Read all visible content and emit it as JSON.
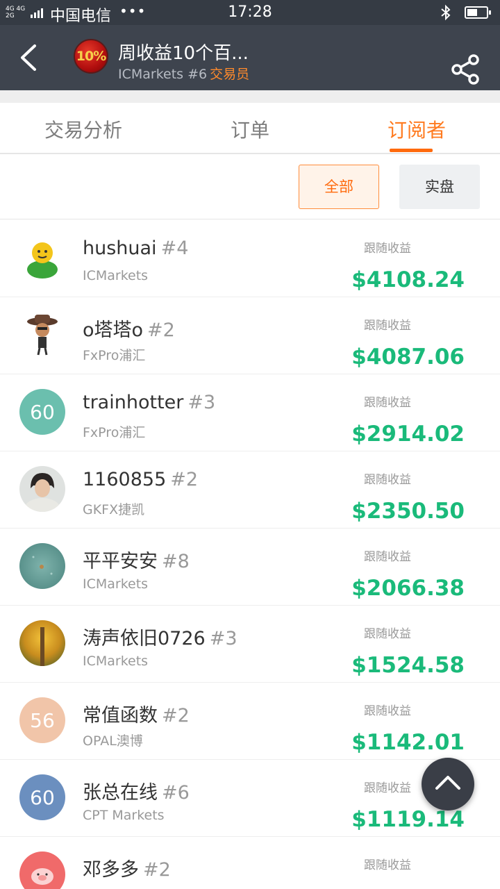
{
  "status_bar": {
    "network_top": "4G 4G",
    "network_bottom": "2G",
    "carrier": "中国电信",
    "dots": "•••",
    "time": "17:28"
  },
  "header": {
    "logo_text": "10%",
    "title": "周收益10个百...",
    "broker_rank": "ICMarkets #6",
    "role": "交易员"
  },
  "tabs": [
    {
      "label": "交易分析",
      "active": false
    },
    {
      "label": "订单",
      "active": false
    },
    {
      "label": "订阅者",
      "active": true
    }
  ],
  "filters": {
    "all": "全部",
    "real": "实盘"
  },
  "colors": {
    "accent": "#ff6a0d",
    "profit": "#1aba7a",
    "header_bg": "#3e444e",
    "status_bg": "#353b44"
  },
  "subscribers": [
    {
      "name": "hushuai",
      "rank": "#4",
      "broker": "ICMarkets",
      "profit_label": "跟随收益",
      "profit": "$4108.24",
      "avatar_icon": "smiley-avatar-icon"
    },
    {
      "name": "o塔塔o",
      "rank": "#2",
      "broker": "FxPro浦汇",
      "profit_label": "跟随收益",
      "profit": "$4087.06",
      "avatar_icon": "cowboy-avatar-icon"
    },
    {
      "name": "trainhotter",
      "rank": "#3",
      "broker": "FxPro浦汇",
      "profit_label": "跟随收益",
      "profit": "$2914.02",
      "avatar_text": "60",
      "avatar_color": "#6bbfae"
    },
    {
      "name": "1160855",
      "rank": "#2",
      "broker": "GKFX捷凯",
      "profit_label": "跟随收益",
      "profit": "$2350.50",
      "avatar_icon": "person-photo-icon"
    },
    {
      "name": "平平安安",
      "rank": "#8",
      "broker": "ICMarkets",
      "profit_label": "跟随收益",
      "profit": "$2066.38",
      "avatar_icon": "teal-texture-icon"
    },
    {
      "name": "涛声依旧0726",
      "rank": "#3",
      "broker": "ICMarkets",
      "profit_label": "跟随收益",
      "profit": "$1524.58",
      "avatar_icon": "autumn-tree-icon"
    },
    {
      "name": "常值函数",
      "rank": "#2",
      "broker": "OPAL澳博",
      "profit_label": "跟随收益",
      "profit": "$1142.01",
      "avatar_text": "56",
      "avatar_color": "#f1c5a9"
    },
    {
      "name": "张总在线",
      "rank": "#6",
      "broker": "CPT Markets",
      "profit_label": "跟随收益",
      "profit": "$1119.14",
      "avatar_text": "60",
      "avatar_color": "#6b8fbf"
    },
    {
      "name": "邓多多",
      "rank": "#2",
      "broker": "",
      "profit_label": "跟随收益",
      "profit": "",
      "avatar_icon": "pig-avatar-icon"
    }
  ]
}
